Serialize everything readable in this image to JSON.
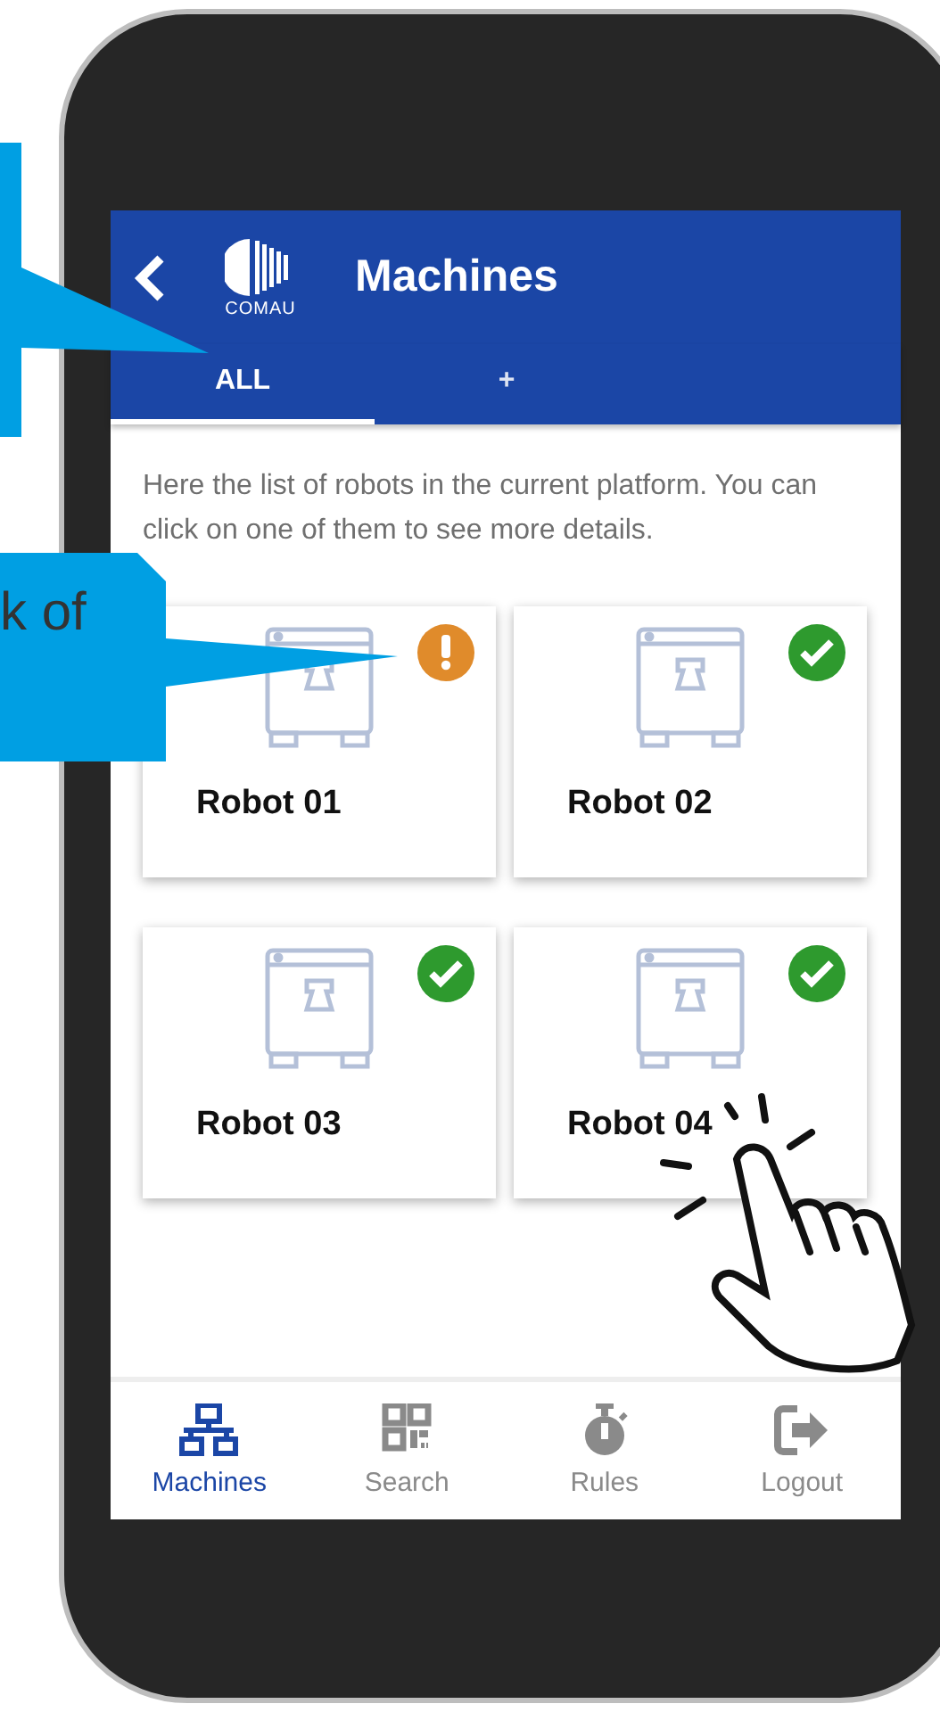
{
  "header": {
    "title": "Machines",
    "logo_text": "COMAU"
  },
  "tabs": [
    {
      "label": "ALL",
      "selected": true
    },
    {
      "label": "+",
      "selected": false
    }
  ],
  "description": "Here the list of robots in the current platform. You can click on one of them to see more details.",
  "robots": [
    {
      "name": "Robot 01",
      "kind": "warning"
    },
    {
      "name": "Robot 02",
      "kind": "ok"
    },
    {
      "name": "Robot 03",
      "kind": "ok"
    },
    {
      "name": "Robot 04",
      "kind": "ok"
    }
  ],
  "bottom_nav": [
    {
      "label": "Machines",
      "selected": true
    },
    {
      "label": "Search",
      "selected": false
    },
    {
      "label": "Rules",
      "selected": false
    },
    {
      "label": "Logout",
      "selected": false
    }
  ],
  "callout": {
    "text": "k of"
  }
}
